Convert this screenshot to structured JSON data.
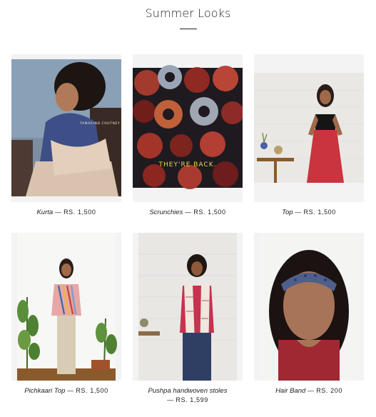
{
  "section": {
    "title": "Summer Looks"
  },
  "products": [
    {
      "name": "Kurta",
      "separator": "—",
      "price": "RS. 1,500",
      "photo": "woman-seated-kurta-photo",
      "overlay_text": "TAMARIND CHUTNEY"
    },
    {
      "name": "Scrunchies",
      "separator": "—",
      "price": "RS. 1,500",
      "photo": "scrunchies-pile-photo",
      "overlay_text": "THEY'RE BACK."
    },
    {
      "name": "Top",
      "separator": "—",
      "price": "RS. 1,500",
      "photo": "woman-black-top-red-skirt-photo"
    },
    {
      "name": "Pichkaari Top",
      "separator": "—",
      "price": "RS. 1,500",
      "photo": "woman-striped-top-plants-photo"
    },
    {
      "name": "Pushpa handwoven stoles",
      "separator": "—",
      "price": "RS. 1,599",
      "photo": "woman-stole-photo"
    },
    {
      "name": "Hair Band",
      "separator": "—",
      "price": "RS. 200",
      "photo": "woman-hairband-photo"
    }
  ],
  "colors": {
    "text": "#222222",
    "frame_bg": "#f3f3f3",
    "scrunchie_overlay": "#e7d84a"
  }
}
